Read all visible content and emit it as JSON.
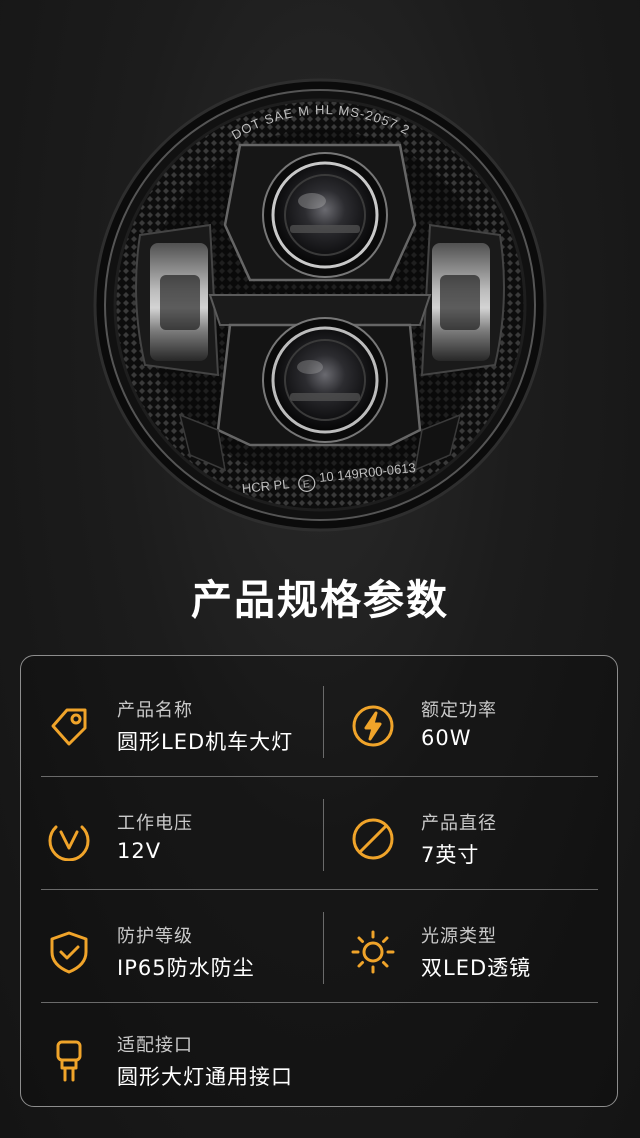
{
  "headlight": {
    "top_marking": "DOT SAE M HL MS-2057 23",
    "bottom_marking_left": "HCR PL",
    "bottom_marking_circle": "E",
    "bottom_marking_right": "10 149R00-0613"
  },
  "title": "产品规格参数",
  "specs": [
    {
      "icon": "price-tag-icon",
      "label": "产品名称",
      "value": "圆形LED机车大灯"
    },
    {
      "icon": "lightning-icon",
      "label": "额定功率",
      "value": "60W"
    },
    {
      "icon": "voltage-icon",
      "label": "工作电压",
      "value": "12V"
    },
    {
      "icon": "diameter-icon",
      "label": "产品直径",
      "value": "7英寸"
    },
    {
      "icon": "shield-check-icon",
      "label": "防护等级",
      "value": "IP65防水防尘"
    },
    {
      "icon": "sun-icon",
      "label": "光源类型",
      "value": "双LED透镜"
    },
    {
      "icon": "bulb-connector-icon",
      "label": "适配接口",
      "value": "圆形大灯通用接口"
    }
  ],
  "colors": {
    "accent": "#f0a42a",
    "card_border": "#8d8d8d",
    "background": "#1c1c1c"
  }
}
